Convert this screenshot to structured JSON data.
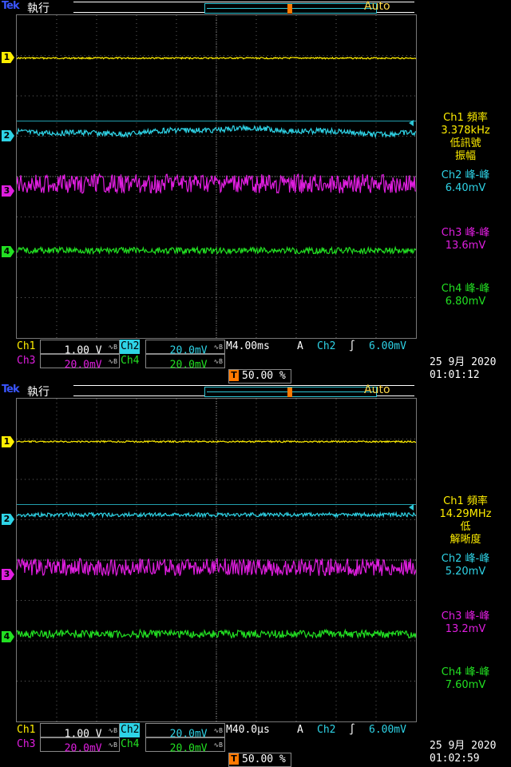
{
  "colors": {
    "ch1": "#ffee00",
    "ch2": "#2ed3e6",
    "ch3": "#e01ee0",
    "ch4": "#22e022",
    "trigger": "#ff7a00",
    "grid": "#666666"
  },
  "screens": [
    {
      "header": {
        "logo": "Tek",
        "run_state": "執行",
        "trigger_mode": "Auto"
      },
      "markers": {
        "trigger": "T",
        "ch1": "1",
        "ch2": "2",
        "ch3": "3",
        "ch4": "4"
      },
      "measurements": [
        {
          "label": "Ch1 頻率",
          "value": "3.378kHz",
          "note1": "低訊號",
          "note2": "振幅",
          "color": "#ffee00"
        },
        {
          "label": "Ch2 峰-峰",
          "value": "6.40mV",
          "color": "#2ed3e6"
        },
        {
          "label": "Ch3 峰-峰",
          "value": "13.6mV",
          "color": "#e01ee0"
        },
        {
          "label": "Ch4 峰-峰",
          "value": "6.80mV",
          "color": "#22e022"
        }
      ],
      "settings": {
        "ch1_label": "Ch1",
        "ch1_scale": "1.00 V",
        "ch2_label": "Ch2",
        "ch2_scale": "20.0mV",
        "ch3_label": "Ch3",
        "ch3_scale": "20.0mV",
        "ch4_label": "Ch4",
        "ch4_scale": "20.0mV",
        "timebase": "M4.00ms",
        "coupling": "A",
        "trig_source": "Ch2",
        "trig_slope": "∫",
        "trig_level": "6.00mV",
        "trig_position": "50.00 %",
        "date": "25 9月  2020",
        "time": "01:01:12"
      },
      "traces": {
        "ch1_noise": 1.0,
        "ch2_noise": 3.5,
        "ch3_noise": 12,
        "ch4_noise": 4,
        "ch2_wander": 3
      }
    },
    {
      "header": {
        "logo": "Tek",
        "run_state": "執行",
        "trigger_mode": "Auto"
      },
      "markers": {
        "trigger": "T",
        "ch1": "1",
        "ch2": "2",
        "ch3": "3",
        "ch4": "4"
      },
      "measurements": [
        {
          "label": "Ch1 頻率",
          "value": "14.29MHz",
          "note1": "低",
          "note2": "解晰度",
          "color": "#ffee00"
        },
        {
          "label": "Ch2 峰-峰",
          "value": "5.20mV",
          "color": "#2ed3e6"
        },
        {
          "label": "Ch3 峰-峰",
          "value": "13.2mV",
          "color": "#e01ee0"
        },
        {
          "label": "Ch4 峰-峰",
          "value": "7.60mV",
          "color": "#22e022"
        }
      ],
      "settings": {
        "ch1_label": "Ch1",
        "ch1_scale": "1.00 V",
        "ch2_label": "Ch2",
        "ch2_scale": "20.0mV",
        "ch3_label": "Ch3",
        "ch3_scale": "20.0mV",
        "ch4_label": "Ch4",
        "ch4_scale": "20.0mV",
        "timebase": "M40.0µs",
        "coupling": "A",
        "trig_source": "Ch2",
        "trig_slope": "∫",
        "trig_level": "6.00mV",
        "trig_position": "50.00 %",
        "date": "25 9月  2020",
        "time": "01:02:59"
      },
      "traces": {
        "ch1_noise": 1.0,
        "ch2_noise": 2.5,
        "ch3_noise": 11,
        "ch4_noise": 5,
        "ch2_wander": 0
      }
    }
  ]
}
